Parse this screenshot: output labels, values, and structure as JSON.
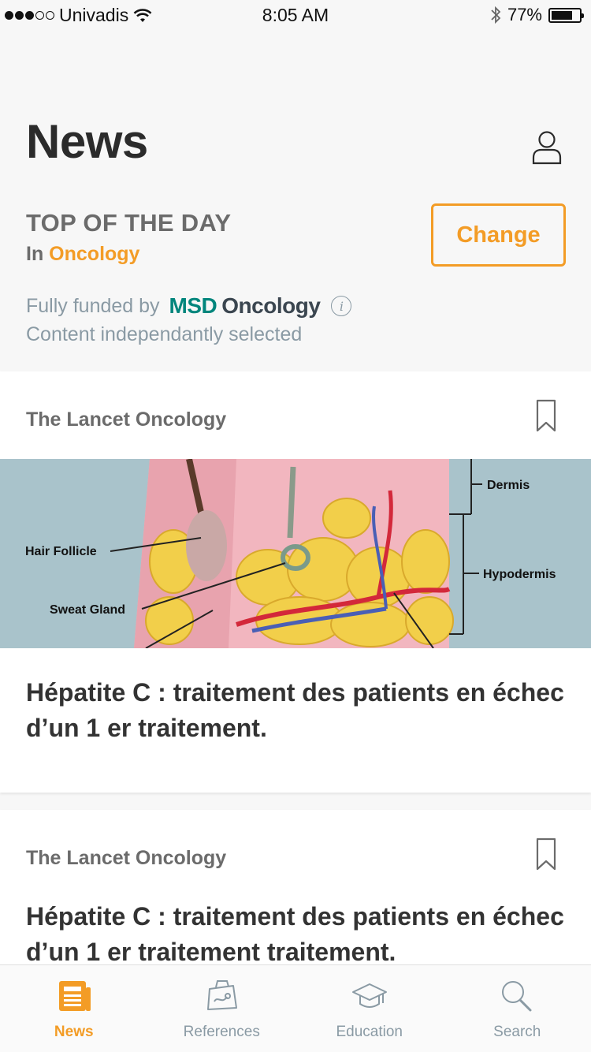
{
  "status_bar": {
    "carrier": "Univadis",
    "time": "8:05 AM",
    "battery": "77%",
    "battery_level": 0.77
  },
  "header": {
    "title": "News"
  },
  "top_of_day": {
    "heading": "TOP OF THE DAY",
    "in_prefix": "In",
    "specialty": "Oncology",
    "change_label": "Change"
  },
  "sponsor": {
    "funded_by": "Fully funded by",
    "brand_msd": "MSD",
    "brand_oncology": "Oncology",
    "content_note": "Content independantly selected"
  },
  "articles": [
    {
      "source": "The Lancet Oncology",
      "headline": "Hépatite C : traitement des patients en échec d’un 1 er traitement.",
      "image_labels": {
        "dermis": "Dermis",
        "hair_follicle": "Hair Follicle",
        "hypodermis": "Hypodermis",
        "sweat_gland": "Sweat Gland"
      }
    },
    {
      "source": "The Lancet Oncology",
      "headline": "Hépatite C : traitement des patients en échec d’un 1 er traitement traitement."
    }
  ],
  "tab_bar": {
    "tabs": [
      {
        "label": "News",
        "icon": "newspaper-icon",
        "active": true
      },
      {
        "label": "References",
        "icon": "references-icon",
        "active": false
      },
      {
        "label": "Education",
        "icon": "graduation-cap-icon",
        "active": false
      },
      {
        "label": "Search",
        "icon": "search-icon",
        "active": false
      }
    ]
  },
  "colors": {
    "accent": "#f39c26",
    "msd_green": "#00857c",
    "muted_text": "#8a9aa4"
  }
}
